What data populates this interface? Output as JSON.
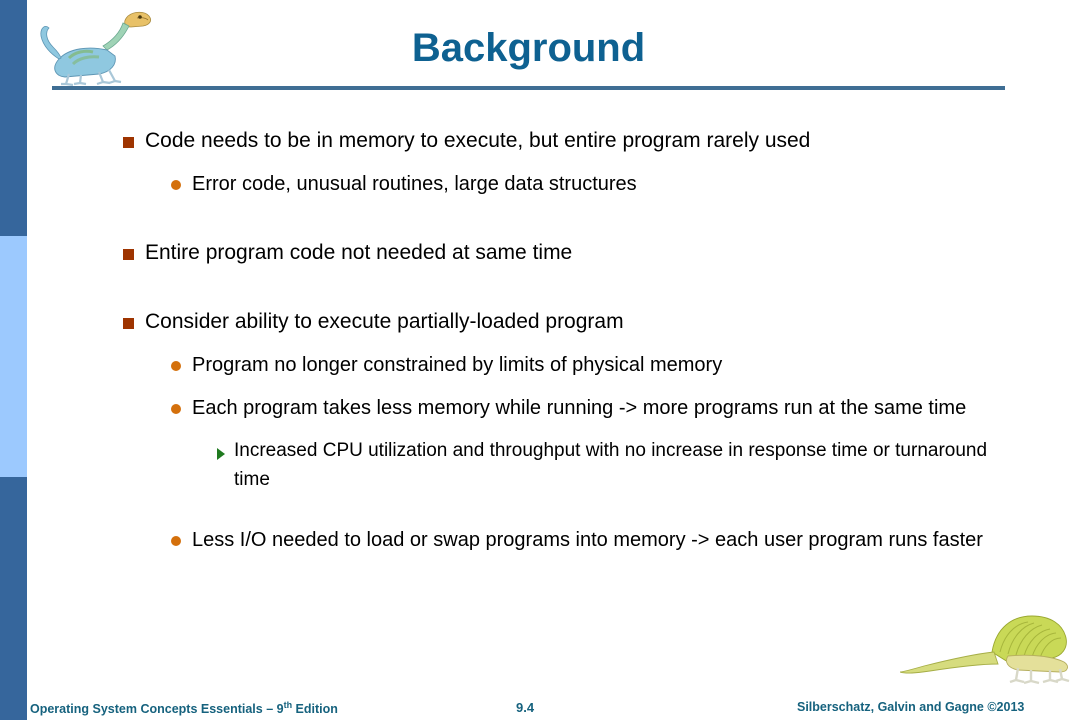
{
  "slide": {
    "title": "Background",
    "accent_title_color": "#0E6191",
    "rule_color": "#3F6E94",
    "sidebar": {
      "bar_top_color": "#36669C",
      "bar_middle_color": "#9CC9FE",
      "bar_bottom_color": "#36669C"
    },
    "bullet_colors": {
      "level1_square": "#9E3400",
      "level2_circle": "#D4700C",
      "level3_triangle": "#1F7A1F"
    },
    "decorations": {
      "top_left_image": "dinosaur-ornithomimid-icon",
      "bottom_right_image": "dinosaur-sailback-icon"
    }
  },
  "body": {
    "items": [
      {
        "level": 1,
        "text": "Code needs to be in memory to execute, but entire program rarely used"
      },
      {
        "level": 2,
        "text": "Error code, unusual routines, large data structures"
      },
      {
        "level": 1,
        "text": "Entire program code not needed at same time"
      },
      {
        "level": 1,
        "text": "Consider ability to execute partially-loaded program"
      },
      {
        "level": 2,
        "text": "Program no longer constrained by limits of physical memory"
      },
      {
        "level": 2,
        "text": "Each program takes less memory while running -> more programs run at the same time"
      },
      {
        "level": 3,
        "text": "Increased CPU utilization and throughput with no increase in response time or turnaround time"
      },
      {
        "level": 2,
        "text": "Less I/O needed to load or swap programs into memory -> each user program runs faster"
      }
    ]
  },
  "footer": {
    "book_title_main": "Operating System Concepts Essentials – 9",
    "book_title_sup": "th",
    "book_title_tail": " Edition",
    "page_number": "9.4",
    "copyright": "Silberschatz, Galvin and Gagne ©2013"
  }
}
